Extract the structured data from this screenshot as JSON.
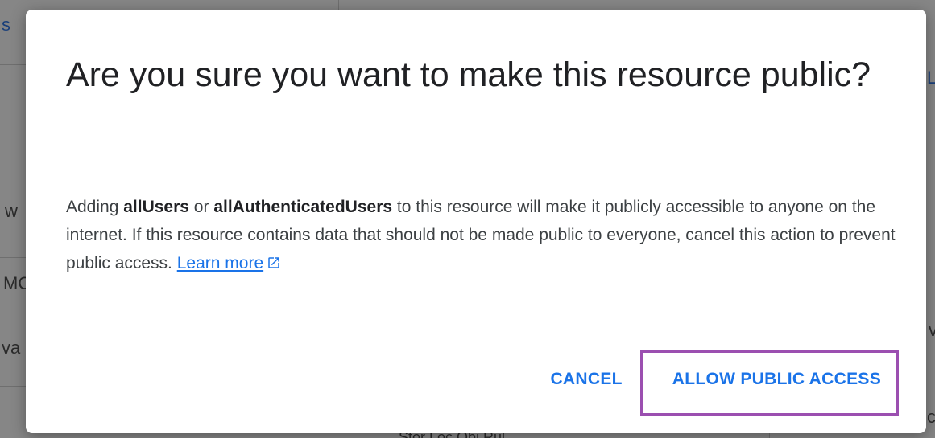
{
  "background": {
    "fragments": [
      "s",
      "L",
      "w",
      "MC",
      "va",
      "v",
      "c",
      "Stor Loc Obj Rul"
    ]
  },
  "dialog": {
    "title": "Are you sure you want to make this resource public?",
    "body": {
      "part1": "Adding ",
      "bold1": "allUsers",
      "part2": " or ",
      "bold2": "allAuthenticatedUsers",
      "part3": " to this resource will make it publicly accessible to anyone on the internet. If this resource contains data that should not be made public to everyone, cancel this action to prevent public access. ",
      "link_label": "Learn more"
    },
    "icons": {
      "link": "external-link-icon"
    },
    "buttons": {
      "cancel_label": "CANCEL",
      "allow_label": "ALLOW PUBLIC ACCESS"
    }
  },
  "colors": {
    "accent": "#1a73e8",
    "highlight": "#9b4fb0"
  }
}
